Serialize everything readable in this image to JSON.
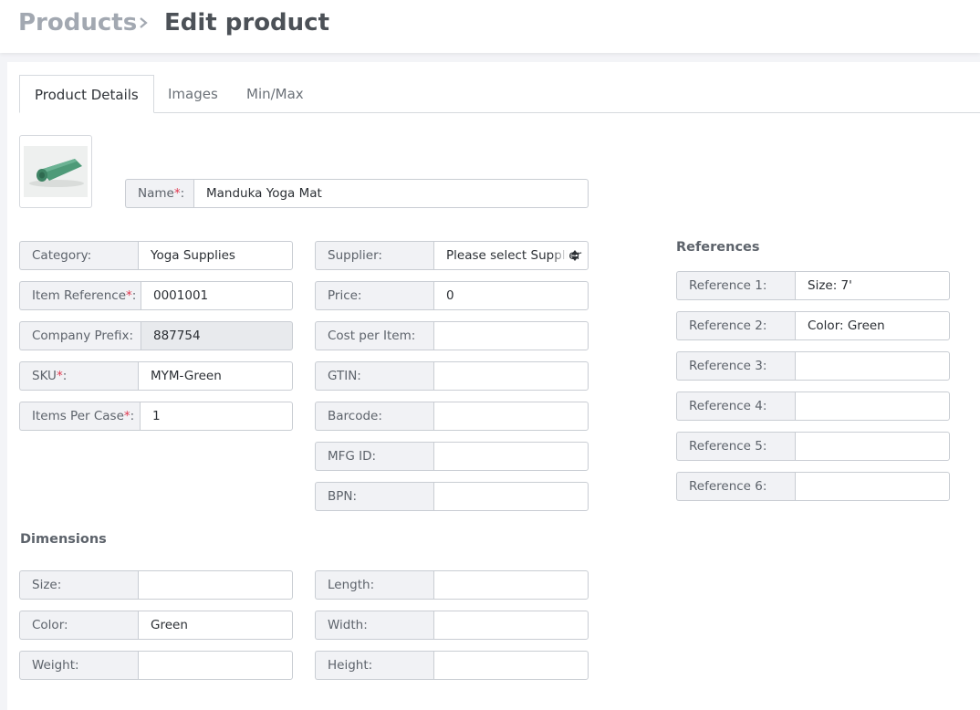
{
  "breadcrumb": {
    "root": "Products",
    "current": "Edit product"
  },
  "tabs": [
    {
      "label": "Product Details",
      "active": true
    },
    {
      "label": "Images",
      "active": false
    },
    {
      "label": "Min/Max",
      "active": false
    }
  ],
  "product_image": {
    "description_icon": "yoga-mat-image"
  },
  "name": {
    "label": "Name",
    "required": true,
    "value": "Manduka Yoga Mat"
  },
  "left_fields": {
    "category": {
      "label": "Category:",
      "value": "Yoga Supplies"
    },
    "item_reference": {
      "label": "Item Reference",
      "value": "0001001"
    },
    "company_prefix": {
      "label": "Company Prefix:",
      "value": "887754"
    },
    "sku": {
      "label": "SKU",
      "value": "MYM-Green"
    },
    "items_per_case": {
      "label": "Items Per Case",
      "value": "1"
    }
  },
  "middle_fields": {
    "supplier": {
      "label": "Supplier:",
      "value": "Please select Supplier"
    },
    "price": {
      "label": "Price:",
      "value": "0"
    },
    "cost_per_item": {
      "label": "Cost per Item:",
      "value": ""
    },
    "gtin": {
      "label": "GTIN:",
      "value": ""
    },
    "barcode": {
      "label": "Barcode:",
      "value": ""
    },
    "mfg_id": {
      "label": "MFG ID:",
      "value": ""
    },
    "bpn": {
      "label": "BPN:",
      "value": ""
    }
  },
  "references": {
    "title": "References",
    "items": [
      {
        "label": "Reference 1:",
        "value": "Size: 7'"
      },
      {
        "label": "Reference 2:",
        "value": "Color: Green"
      },
      {
        "label": "Reference 3:",
        "value": ""
      },
      {
        "label": "Reference 4:",
        "value": ""
      },
      {
        "label": "Reference 5:",
        "value": ""
      },
      {
        "label": "Reference 6:",
        "value": ""
      }
    ]
  },
  "dimensions": {
    "title": "Dimensions",
    "size": {
      "label": "Size:",
      "value": ""
    },
    "color": {
      "label": "Color:",
      "value": "Green"
    },
    "weight": {
      "label": "Weight:",
      "value": ""
    },
    "length": {
      "label": "Length:",
      "value": ""
    },
    "width": {
      "label": "Width:",
      "value": ""
    },
    "height": {
      "label": "Height:",
      "value": ""
    }
  },
  "colors": {
    "required_marker": "#e0384f",
    "label_bg": "#f1f2f5",
    "border": "#c9cdd3",
    "mat_green": "#4e9a78"
  }
}
